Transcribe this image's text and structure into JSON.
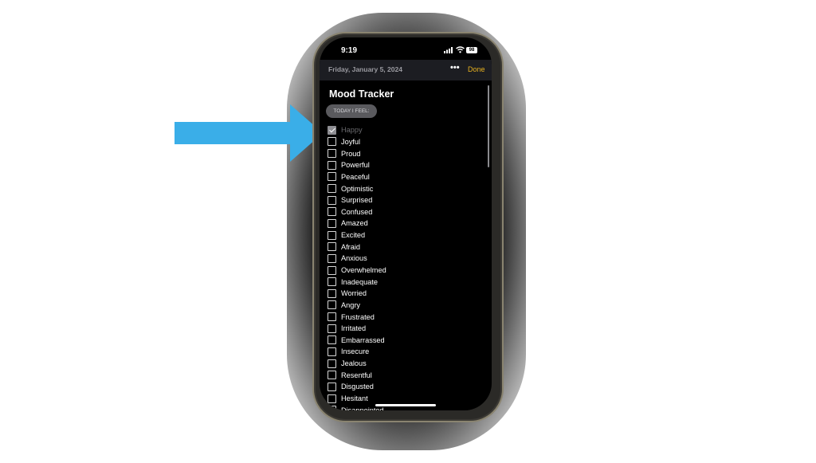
{
  "status_bar": {
    "time": "9:19",
    "battery": "98"
  },
  "nav": {
    "date": "Friday, January 5, 2024",
    "more": "•••",
    "done": "Done"
  },
  "page": {
    "title": "Mood Tracker",
    "prompt_button": "TODAY I FEEL:"
  },
  "moods": [
    {
      "label": "Happy",
      "checked": true
    },
    {
      "label": "Joyful",
      "checked": false
    },
    {
      "label": "Proud",
      "checked": false
    },
    {
      "label": "Powerful",
      "checked": false
    },
    {
      "label": "Peaceful",
      "checked": false
    },
    {
      "label": "Optimistic",
      "checked": false
    },
    {
      "label": "Surprised",
      "checked": false
    },
    {
      "label": "Confused",
      "checked": false
    },
    {
      "label": "Amazed",
      "checked": false
    },
    {
      "label": "Excited",
      "checked": false
    },
    {
      "label": "Afraid",
      "checked": false
    },
    {
      "label": "Anxious",
      "checked": false
    },
    {
      "label": "Overwhelmed",
      "checked": false
    },
    {
      "label": "Inadequate",
      "checked": false
    },
    {
      "label": "Worried",
      "checked": false
    },
    {
      "label": "Angry",
      "checked": false
    },
    {
      "label": "Frustrated",
      "checked": false
    },
    {
      "label": "Irritated",
      "checked": false
    },
    {
      "label": "Embarrassed",
      "checked": false
    },
    {
      "label": "Insecure",
      "checked": false
    },
    {
      "label": "Jealous",
      "checked": false
    },
    {
      "label": "Resentful",
      "checked": false
    },
    {
      "label": "Disgusted",
      "checked": false
    },
    {
      "label": "Hesitant",
      "checked": false
    },
    {
      "label": "Disappointed",
      "checked": false
    }
  ],
  "colors": {
    "accent": "#e8b21f",
    "arrow": "#3aaee8",
    "background": "#000000"
  }
}
